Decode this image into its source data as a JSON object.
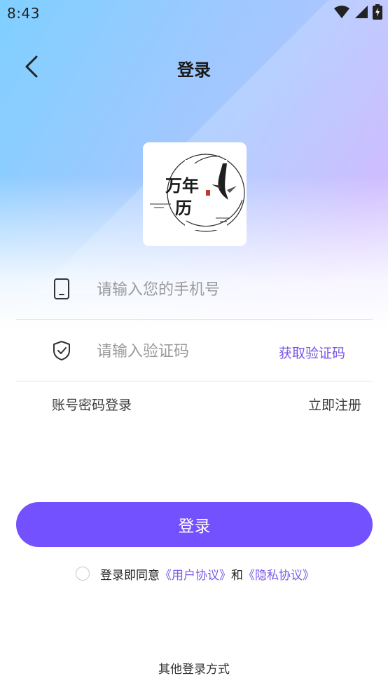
{
  "status_bar": {
    "time": "8:43",
    "icons": [
      "wifi-icon",
      "signal-icon",
      "battery-charging-icon"
    ]
  },
  "header": {
    "back_icon": "chevron-left-icon",
    "title": "登录"
  },
  "logo": {
    "text_line1": "万年",
    "text_line2": "历"
  },
  "form": {
    "phone": {
      "icon": "phone-icon",
      "value": "",
      "placeholder": "请输入您的手机号"
    },
    "code": {
      "icon": "shield-check-icon",
      "value": "",
      "placeholder": "请输入验证码",
      "get_code_label": "获取验证码"
    },
    "password_login_label": "账号密码登录",
    "register_label": "立即注册"
  },
  "login_button_label": "登录",
  "agreement": {
    "checked": false,
    "prefix": "登录即同意",
    "user_agreement": "《用户协议》",
    "and": "和",
    "privacy_agreement": "《隐私协议》"
  },
  "other_login_label": "其他登录方式",
  "colors": {
    "accent": "#7451fe",
    "link": "#7a5ae8"
  }
}
